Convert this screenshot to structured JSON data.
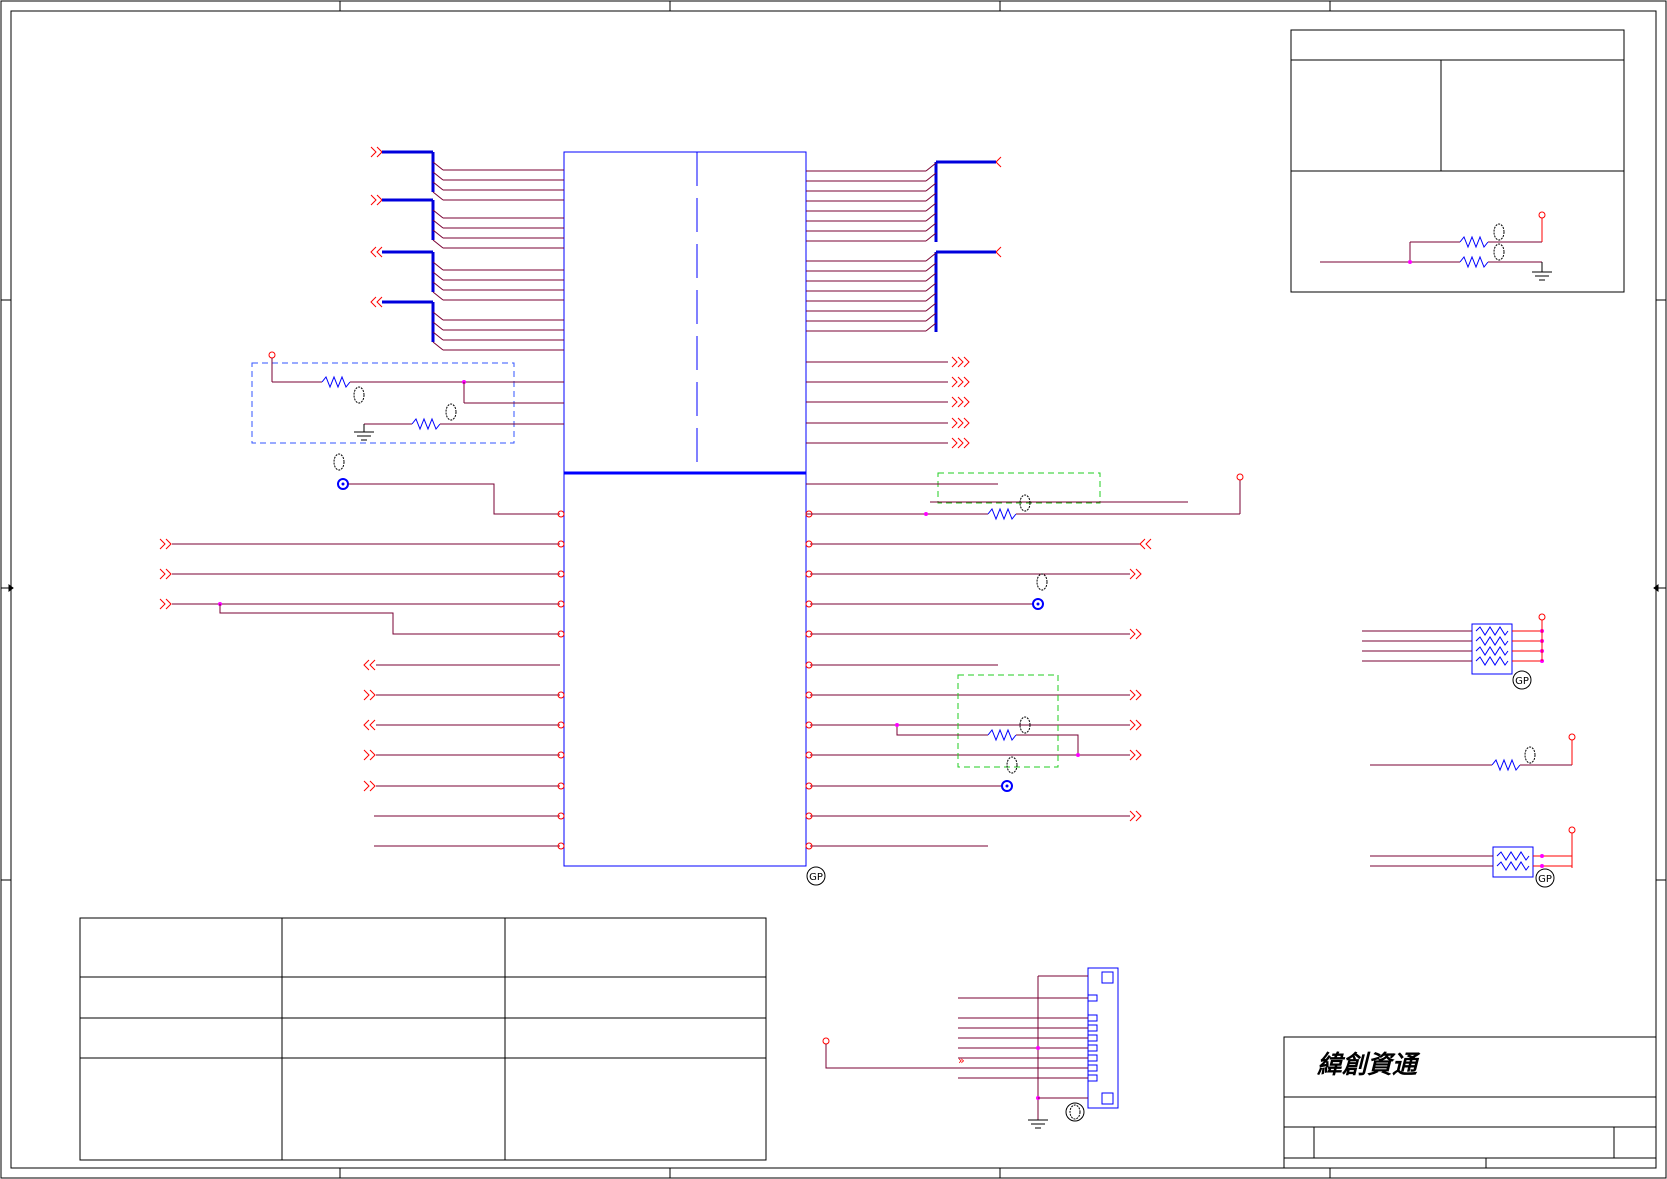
{
  "company_logo": "緯創資通",
  "tags": {
    "gp": "GP"
  },
  "colors": {
    "net_red": "#ff0000",
    "wire_dark": "#7a0033",
    "bus_blue": "#0000dd",
    "part_blue": "#0000ff",
    "junction": "#ff00ff",
    "group_blue_dash": "#3355ff",
    "group_green_dash": "#22cc22",
    "frame": "#000000"
  },
  "icons": [
    "offpage-connector-icon",
    "resistor-icon",
    "ground-icon",
    "power-rail-icon",
    "test-point-icon",
    "resistor-pack-icon",
    "connector-icon"
  ]
}
